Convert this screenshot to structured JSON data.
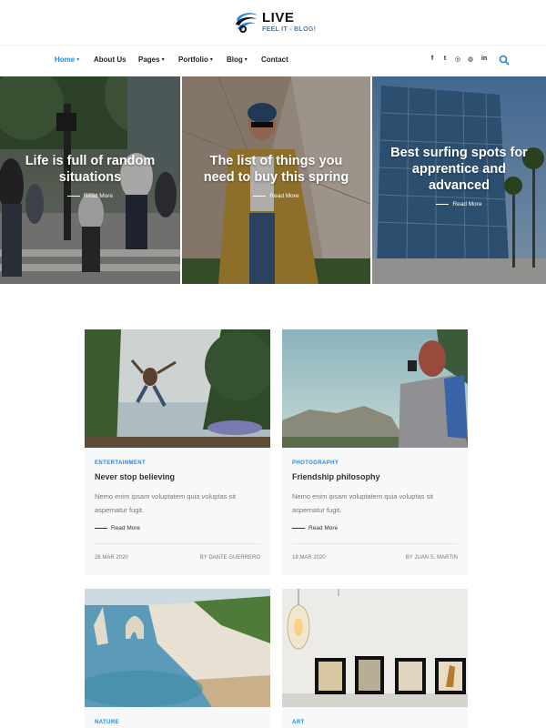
{
  "brand": {
    "title": "LIVE",
    "tagline": "FEEL IT - BLOG!"
  },
  "nav": {
    "home": "Home",
    "about": "About Us",
    "pages": "Pages",
    "portfolio": "Portfolio",
    "blog": "Blog",
    "contact": "Contact",
    "social": {
      "facebook": "f",
      "twitter": "t",
      "instagram": "◎",
      "dribbble": "◍",
      "linkedin": "in"
    },
    "search_icon": "search-icon"
  },
  "hero": [
    {
      "title_line1": "Life is full of random",
      "title_line2": "situations",
      "read_more": "Read More"
    },
    {
      "title_line1": "The list of things you",
      "title_line2": "need to buy this spring",
      "read_more": "Read More"
    },
    {
      "title_line1": "Best surfing spots for",
      "title_line2": "apprentice and",
      "title_line3": "advanced",
      "read_more": "Read More"
    }
  ],
  "posts": [
    {
      "category": "ENTERTAINMENT",
      "title": "Never stop believing",
      "excerpt_line1": "Nemo enim ipsam voluptatem quia voluptas sit",
      "excerpt_line2": "aspernatur fugit.",
      "read_more": "Read More",
      "date": "26 MAR 2020",
      "author": "BY DANTE GUERRERO"
    },
    {
      "category": "PHOTOGRAPHY",
      "title": "Friendship philosophy",
      "excerpt_line1": "Nemo enim ipsam voluptatem quia voluptas sit",
      "excerpt_line2": "aspernatur fugit.",
      "read_more": "Read More",
      "date": "18 MAR 2020",
      "author": "BY JUAN S. MARTIN"
    },
    {
      "category": "NATURE"
    },
    {
      "category": "ART"
    }
  ],
  "colors": {
    "accent": "#1e88e5",
    "text": "#222222",
    "muted": "#777777",
    "card_bg": "#f7f8fa"
  }
}
